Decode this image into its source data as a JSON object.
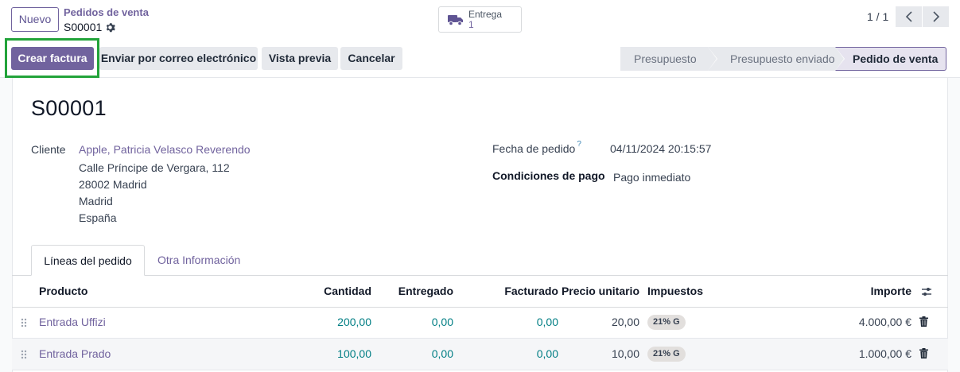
{
  "control_panel": {
    "new_button": "Nuevo",
    "breadcrumb_parent": "Pedidos de venta",
    "breadcrumb_current": "S00001",
    "smart_button": {
      "label": "Entrega",
      "value": "1",
      "icon": "truck-icon"
    },
    "pager": "1 / 1"
  },
  "statusbar": {
    "buttons": [
      "Crear factura",
      "Enviar por correo electrónico",
      "Vista previa",
      "Cancelar"
    ],
    "stages": [
      "Presupuesto",
      "Presupuesto enviado",
      "Pedido de venta"
    ],
    "active_stage": "Pedido de venta"
  },
  "form": {
    "title": "S00001",
    "customer_label": "Cliente",
    "customer_name": "Apple, Patricia Velasco Reverendo",
    "address": [
      "Calle Príncipe de Vergara, 112",
      "28002 Madrid",
      "Madrid",
      "España"
    ],
    "order_date_label": "Fecha de pedido",
    "order_date_help": "?",
    "order_date": "04/11/2024 20:15:57",
    "payment_terms_label": "Condiciones de pago",
    "payment_terms": "Pago inmediato"
  },
  "tabs": [
    "Líneas del pedido",
    "Otra Información"
  ],
  "table": {
    "columns": [
      "Producto",
      "Cantidad",
      "Entregado",
      "Facturado",
      "Precio unitario",
      "Impuestos",
      "Importe"
    ],
    "rows": [
      {
        "product": "Entrada Uffizi",
        "qty": "200,00",
        "delivered": "0,00",
        "invoiced": "0,00",
        "unit_price": "20,00",
        "tax": "21% G",
        "amount": "4.000,00 €"
      },
      {
        "product": "Entrada Prado",
        "qty": "100,00",
        "delivered": "0,00",
        "invoiced": "0,00",
        "unit_price": "10,00",
        "tax": "21% G",
        "amount": "1.000,00 €"
      }
    ]
  },
  "colors": {
    "primary": "#71639e",
    "link_teal": "#017e84",
    "highlight": "#22a33a"
  }
}
